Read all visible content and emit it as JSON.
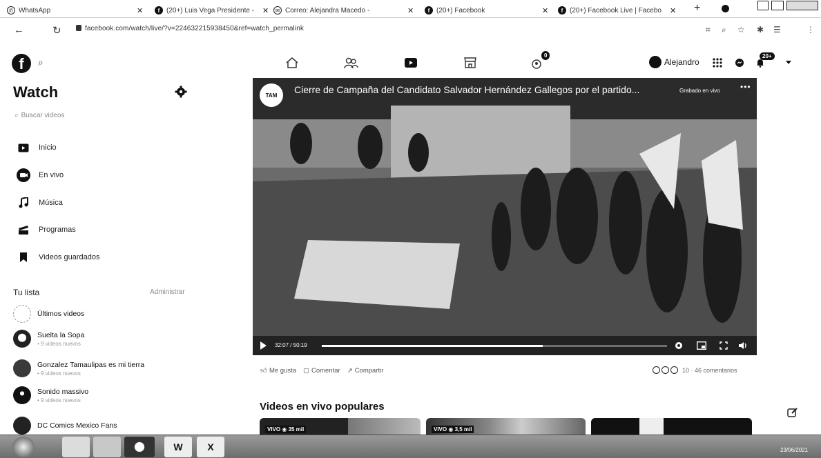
{
  "browser": {
    "tabs": [
      {
        "label": "WhatsApp"
      },
      {
        "label": "(20+) Luis Vega Presidente - "
      },
      {
        "label": "Correo: Alejandra Macedo - "
      },
      {
        "label": "(20+) Facebook"
      },
      {
        "label": "(20+) Facebook Live | Facebo"
      }
    ],
    "url": "facebook.com/watch/live/?v=224632215938450&ref=watch_permalink"
  },
  "header": {
    "user_name": "Alejandro",
    "notif_badge": "20+",
    "groups_badge": "0"
  },
  "sidebar": {
    "title": "Watch",
    "search_placeholder": "Buscar videos",
    "items": [
      {
        "label": "Inicio",
        "icon": "tv-icon"
      },
      {
        "label": "En vivo",
        "icon": "live-icon"
      },
      {
        "label": "Música",
        "icon": "music-icon"
      },
      {
        "label": "Programas",
        "icon": "shows-icon"
      },
      {
        "label": "Videos guardados",
        "icon": "bookmark-icon"
      }
    ],
    "list_title": "Tu lista",
    "manage_label": "Administrar",
    "list": [
      {
        "name": "Últimos videos",
        "sub": ""
      },
      {
        "name": "Suelta la Sopa",
        "sub": "• 9 videos nuevos"
      },
      {
        "name": "Gonzalez Tamaulipas es mi tierra",
        "sub": "• 9 videos nuevos"
      },
      {
        "name": "Sonido massivo",
        "sub": "• 9 videos nuevos"
      },
      {
        "name": "DC Comics Mexico Fans",
        "sub": ""
      }
    ]
  },
  "video": {
    "channel_logo": "TAM",
    "title": "Cierre de Campaña del Candidato Salvador Hernández Gallegos por el partido...",
    "status": "Grabado en vivo",
    "time": "32:07 / 50:19",
    "progress_fraction": 0.64
  },
  "actions": {
    "like": "Me gusta",
    "comment": "Comentar",
    "share": "Compartir",
    "reactions_text": "10 · 46 comentarios"
  },
  "popular": {
    "title": "Videos en vivo populares",
    "cards": [
      {
        "live": "VIVO",
        "viewers": "35 mil"
      },
      {
        "live": "VIVO",
        "viewers": "3,5 mil"
      },
      {
        "live": "",
        "viewers": ""
      }
    ]
  },
  "taskbar": {
    "date": "23/06/2021"
  }
}
